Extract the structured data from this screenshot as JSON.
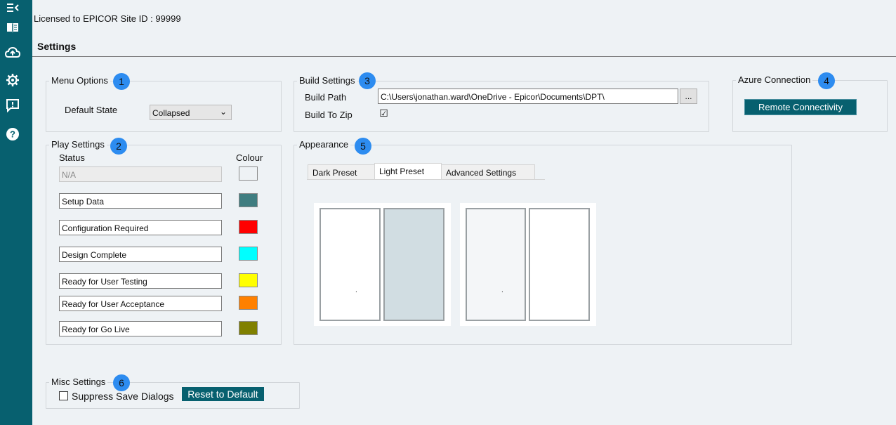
{
  "sidebar": {
    "icons": [
      {
        "name": "collapse-menu-icon"
      },
      {
        "name": "book-icon"
      },
      {
        "name": "cloud-upload-icon"
      },
      {
        "name": "gear-icon"
      },
      {
        "name": "feedback-icon"
      },
      {
        "name": "help-icon"
      }
    ]
  },
  "header": {
    "license": "Licensed to EPICOR Site ID : 99999",
    "title": "Settings"
  },
  "menu_options": {
    "legend": "Menu Options",
    "badge": "1",
    "default_state_label": "Default State",
    "default_state_value": "Collapsed"
  },
  "play_settings": {
    "legend": "Play Settings",
    "badge": "2",
    "status_header": "Status",
    "colour_header": "Colour",
    "rows": [
      {
        "status": "N/A",
        "colour": "#eef2f5",
        "disabled": true
      },
      {
        "status": "Setup Data",
        "colour": "#3f7d80"
      },
      {
        "status": "Configuration Required",
        "colour": "#ff0000"
      },
      {
        "status": "Design Complete",
        "colour": "#00ffff"
      },
      {
        "status": "Ready for User Testing",
        "colour": "#ffff00"
      },
      {
        "status": "Ready for User Acceptance",
        "colour": "#ff8000"
      },
      {
        "status": "Ready for Go Live",
        "colour": "#808000"
      }
    ]
  },
  "build_settings": {
    "legend": "Build Settings",
    "badge": "3",
    "build_path_label": "Build Path",
    "build_path_value": "C:\\Users\\jonathan.ward\\OneDrive - Epicor\\Documents\\DPT\\",
    "browse_label": "...",
    "build_to_zip_label": "Build To Zip",
    "build_to_zip_checked": "☑"
  },
  "azure": {
    "legend": "Azure Connection",
    "badge": "4",
    "button_label": "Remote Connectivity"
  },
  "appearance": {
    "legend": "Appearance",
    "badge": "5",
    "tabs": [
      {
        "label": "Dark Preset"
      },
      {
        "label": "Light Preset"
      },
      {
        "label": "Advanced Settings"
      }
    ],
    "active_tab": "Light Preset",
    "preview_dot": "."
  },
  "misc": {
    "legend": "Misc Settings",
    "badge": "6",
    "suppress_label": "Suppress Save Dialogs",
    "reset_label": "Reset to Default"
  },
  "colors": {
    "accent": "#07606f",
    "badge": "#2d8cf0"
  }
}
